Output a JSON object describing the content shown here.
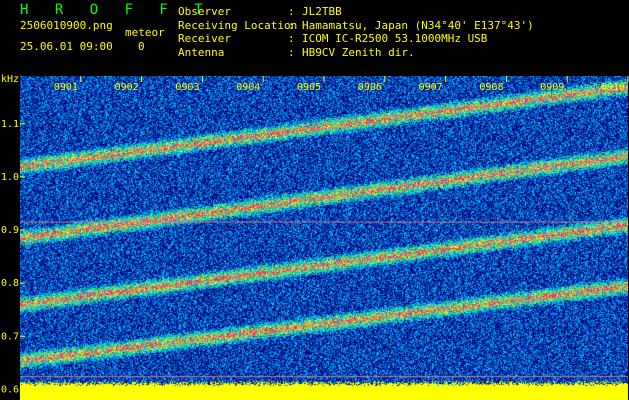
{
  "app": {
    "logo": "H R O F F T"
  },
  "file": {
    "name": "2506010900.png",
    "datetime": "25.06.01 09:00"
  },
  "meteor": {
    "label": "meteor",
    "count": "0"
  },
  "station": [
    {
      "key": "Observer",
      "value": "JL2TBB"
    },
    {
      "key": "Receiving Location",
      "value": "Hamamatsu, Japan (N34°40' E137°43')"
    },
    {
      "key": "Receiver",
      "value": "ICOM IC-R2500 53.1000MHz USB"
    },
    {
      "key": "Antenna",
      "value": "HB9CV Zenith dir."
    }
  ],
  "chart_data": {
    "type": "heatmap",
    "ylabel": "kHz",
    "y_ticks": [
      "0.6",
      "0.7",
      "0.8",
      "0.9",
      "1.0",
      "1.1"
    ],
    "ylim": [
      0.58,
      1.19
    ],
    "x_ticks": [
      "0901",
      "0902",
      "0903",
      "0904",
      "0905",
      "0906",
      "0907",
      "0908",
      "0909",
      "0910"
    ],
    "xlim_minutes": [
      0,
      10
    ],
    "colors": {
      "low": "#0010a0",
      "mid": "#00c8ff",
      "high": "#ff2060",
      "floor": "#ffff00"
    },
    "echo_bands": [
      {
        "start": [
          0,
          0.654
        ],
        "end": [
          10,
          0.795
        ]
      },
      {
        "start": [
          0,
          0.76
        ],
        "end": [
          10,
          0.91
        ]
      },
      {
        "start": [
          0,
          0.885
        ],
        "end": [
          10,
          1.04
        ]
      },
      {
        "start": [
          0,
          1.02
        ],
        "end": [
          10,
          1.17
        ]
      }
    ],
    "carrier_lines": [
      0.915,
      0.624
    ]
  }
}
